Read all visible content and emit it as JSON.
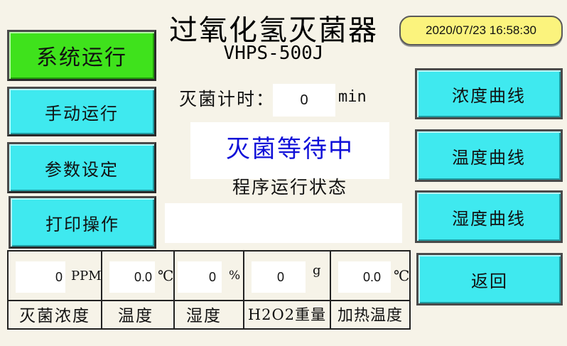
{
  "header": {
    "title": "过氧化氢灭菌器",
    "model": "VHPS-500J",
    "datetime": "2020/07/23 16:58:30"
  },
  "left_menu": [
    {
      "label": "系统运行",
      "active": true
    },
    {
      "label": "手动运行",
      "active": false
    },
    {
      "label": "参数设定",
      "active": false
    },
    {
      "label": "打印操作",
      "active": false
    }
  ],
  "right_menu": [
    {
      "label": "浓度曲线"
    },
    {
      "label": "温度曲线"
    },
    {
      "label": "湿度曲线"
    },
    {
      "label": "返回"
    }
  ],
  "timer": {
    "label": "灭菌计时：",
    "value": "0",
    "unit": "min"
  },
  "status": {
    "text": "灭菌等待中",
    "label": "程序运行状态",
    "message": ""
  },
  "readouts": [
    {
      "value": "0",
      "unit": "PPM",
      "label": "灭菌浓度"
    },
    {
      "value": "0.0",
      "unit": "℃",
      "label": "温度"
    },
    {
      "value": "0",
      "unit": "%",
      "label": "湿度"
    },
    {
      "value": "0",
      "unit": "g",
      "label": "H2O2重量"
    },
    {
      "value": "0.0",
      "unit": "℃",
      "label": "加热温度"
    }
  ],
  "colors": {
    "active_button": "#3fe21c",
    "button": "#3fe9ef",
    "status_text": "#1010d8",
    "datetime_bg": "#fbf37d"
  }
}
